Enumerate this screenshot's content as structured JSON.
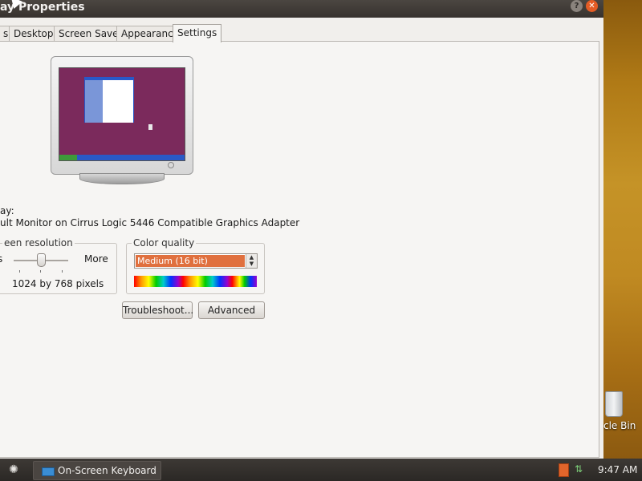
{
  "window": {
    "title": "ay Properties",
    "help_glyph": "?",
    "close_glyph": "✕"
  },
  "tabs": [
    {
      "label": "s"
    },
    {
      "label": "Desktop"
    },
    {
      "label": "Screen Saver"
    },
    {
      "label": "Appearance"
    },
    {
      "label": "Settings",
      "active": true
    }
  ],
  "display": {
    "label": "ay:",
    "value": "ult Monitor on Cirrus Logic 5446 Compatible Graphics Adapter"
  },
  "resolution": {
    "legend": "een resolution",
    "less_label": "s",
    "more_label": "More",
    "value": "1024 by 768 pixels",
    "slider_level": 0.5
  },
  "color_quality": {
    "legend": "Color quality",
    "selected": "Medium (16 bit)",
    "highlight_color": "#e0703e"
  },
  "buttons": {
    "troubleshoot": "Troubleshoot...",
    "advanced": "Advanced"
  },
  "desktop": {
    "recycle_bin_label": "cle Bin"
  },
  "taskbar": {
    "task_label": "On-Screen Keyboard",
    "clock": "9:47 AM",
    "start_icon": "ubuntu-logo-icon"
  }
}
